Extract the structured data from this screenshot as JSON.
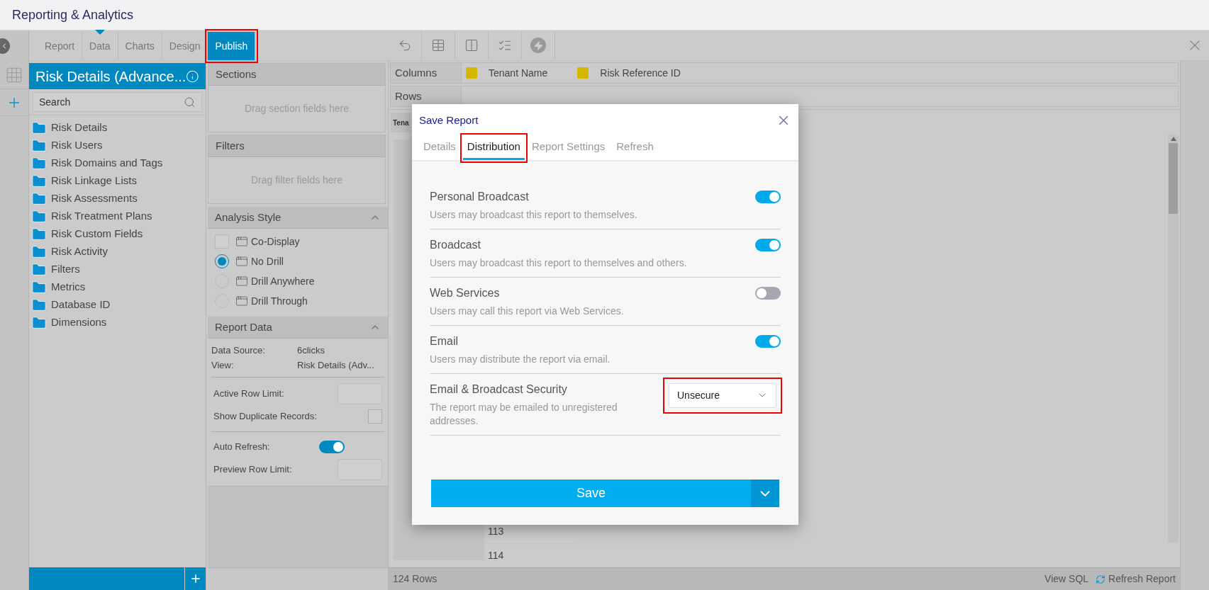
{
  "header": {
    "title": "Reporting & Analytics"
  },
  "main_tabs": [
    {
      "label": "Report",
      "selected": false,
      "caret": false,
      "highlighted": false
    },
    {
      "label": "Data",
      "selected": false,
      "caret": true,
      "highlighted": false
    },
    {
      "label": "Charts",
      "selected": false,
      "caret": false,
      "highlighted": false
    },
    {
      "label": "Design",
      "selected": false,
      "caret": false,
      "highlighted": false
    },
    {
      "label": "Publish",
      "selected": true,
      "caret": false,
      "highlighted": true
    }
  ],
  "left_panel": {
    "title": "Risk Details (Advance...",
    "search": {
      "placeholder": "Search"
    },
    "folders": [
      "Risk Details",
      "Risk Users",
      "Risk Domains and Tags",
      "Risk Linkage Lists",
      "Risk Assessments",
      "Risk Treatment Plans",
      "Risk Custom Fields",
      "Risk Activity",
      "Filters",
      "Metrics",
      "Database ID",
      "Dimensions"
    ]
  },
  "sections": {
    "title": "Sections",
    "hint": "Drag section fields here"
  },
  "filters": {
    "title": "Filters",
    "hint": "Drag filter fields here"
  },
  "analysis_style": {
    "title": "Analysis Style",
    "options": [
      {
        "label": "Co-Display",
        "kind": "checkbox",
        "checked": false
      },
      {
        "label": "No Drill",
        "kind": "radio",
        "selected": true
      },
      {
        "label": "Drill Anywhere",
        "kind": "radio",
        "selected": false
      },
      {
        "label": "Drill Through",
        "kind": "radio",
        "selected": false
      }
    ]
  },
  "report_data": {
    "title": "Report Data",
    "info": [
      {
        "label": "Data Source:",
        "value": "6clicks"
      },
      {
        "label": "View:",
        "value": "Risk Details (Adv..."
      }
    ],
    "active_row_limit": {
      "label": "Active Row Limit:"
    },
    "show_duplicates": {
      "label": "Show Duplicate Records:",
      "checked": false
    },
    "auto_refresh": {
      "label": "Auto Refresh:",
      "on": true
    },
    "preview_row_limit": {
      "label": "Preview Row Limit:"
    }
  },
  "grid": {
    "columns_label": "Columns",
    "column_fields": [
      {
        "label": "Tenant Name",
        "color": "#d4b800"
      },
      {
        "label": "Risk Reference ID",
        "color": "#d4b800"
      }
    ],
    "rows_label": "Rows",
    "header_cell": "Tena",
    "row_numbers": [
      "113",
      "114"
    ],
    "footer": {
      "count": "124 Rows",
      "view_sql": "View SQL",
      "refresh": "Refresh Report"
    }
  },
  "dialog": {
    "title": "Save Report",
    "tabs": [
      {
        "label": "Details",
        "selected": false,
        "highlighted": false
      },
      {
        "label": "Distribution",
        "selected": true,
        "highlighted": true
      },
      {
        "label": "Report Settings",
        "selected": false,
        "highlighted": false
      },
      {
        "label": "Refresh",
        "selected": false,
        "highlighted": false
      }
    ],
    "settings": [
      {
        "kind": "toggle",
        "title": "Personal Broadcast",
        "description": "Users may broadcast this report to themselves.",
        "on": true
      },
      {
        "kind": "toggle",
        "title": "Broadcast",
        "description": "Users may broadcast this report to themselves and others.",
        "on": true
      },
      {
        "kind": "toggle",
        "title": "Web Services",
        "description": "Users may call this report via Web Services.",
        "on": false
      },
      {
        "kind": "toggle",
        "title": "Email",
        "description": "Users may distribute the report via email.",
        "on": true
      },
      {
        "kind": "select",
        "title": "Email & Broadcast Security",
        "description": "The report may be emailed to unregistered addresses.",
        "value": "Unsecure",
        "highlighted": true
      }
    ],
    "save": "Save"
  }
}
